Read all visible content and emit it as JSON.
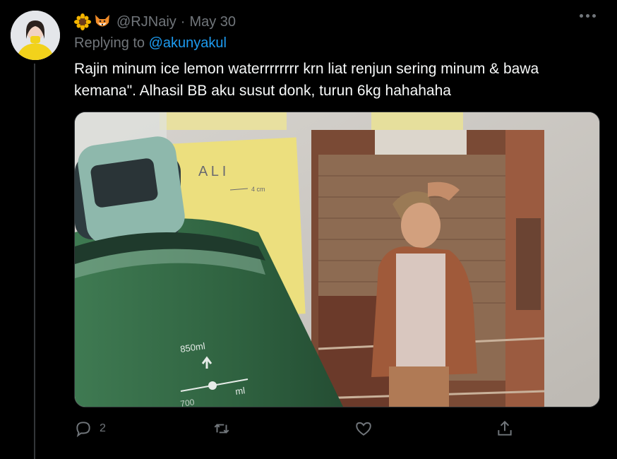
{
  "tweet": {
    "display_name_emojis": [
      "sunflower-emoji",
      "fox-emoji"
    ],
    "handle": "@RJNaiy",
    "separator": "·",
    "date": "May 30",
    "replying_prefix": "Replying to",
    "replying_to": "@akunyakul",
    "text": "Rajin minum ice lemon waterrrrrrrr krn liat renjun sering minum & bawa kemana\". Alhasil BB aku susut donk, turun 6kg hahahaha"
  },
  "media": {
    "bottle_label_volume": "850ml",
    "bottle_label_unit": "ml",
    "bottle_label_partial": "700",
    "sticky_note_text": "A L I",
    "sticky_note_measure": "4 cm"
  },
  "actions": {
    "reply_count": "2",
    "retweet_count": "",
    "like_count": ""
  },
  "icons": {
    "more": "more-horizontal-icon",
    "reply": "reply-icon",
    "retweet": "retweet-icon",
    "like": "heart-icon",
    "share": "share-icon"
  },
  "colors": {
    "background": "#000000",
    "muted": "#71767b",
    "link": "#1d9bf0",
    "text": "#f7f9f9"
  }
}
